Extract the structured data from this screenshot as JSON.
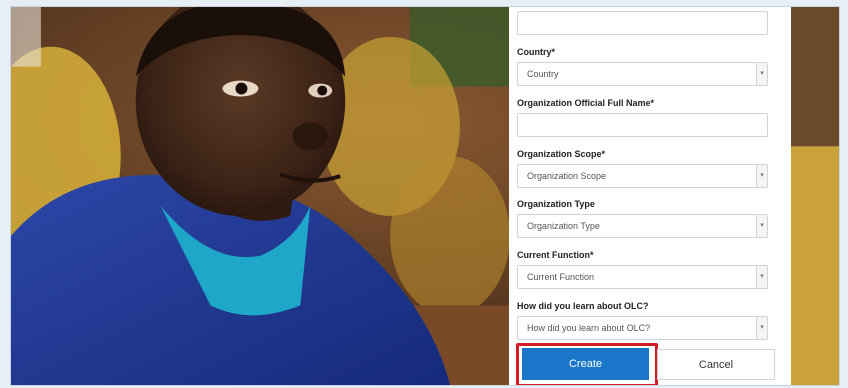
{
  "form": {
    "country": {
      "label": "Country*",
      "placeholder": "Country"
    },
    "org_full_name": {
      "label": "Organization Official Full Name*",
      "value": ""
    },
    "org_scope": {
      "label": "Organization Scope*",
      "placeholder": "Organization Scope"
    },
    "org_type": {
      "label": "Organization Type",
      "placeholder": "Organization Type"
    },
    "current_function": {
      "label": "Current Function*",
      "placeholder": "Current Function"
    },
    "learn_about": {
      "label": "How did you learn about OLC?",
      "placeholder": "How did you learn about OLC?"
    },
    "create_label": "Create",
    "cancel_label": "Cancel"
  },
  "icons": {
    "dropdown": "chevron-down-icon"
  },
  "colors": {
    "primary": "#1976c8",
    "highlight": "#d11b25"
  }
}
